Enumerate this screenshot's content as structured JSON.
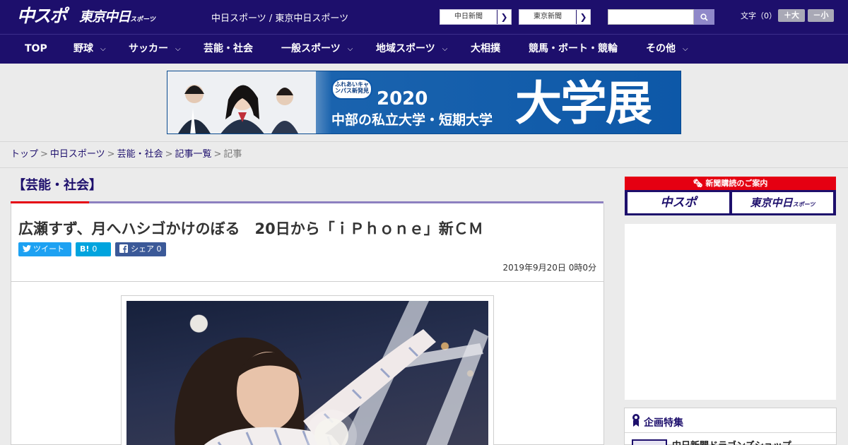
{
  "header": {
    "logo_main": "中スポ",
    "logo_tokyo": "東京中日",
    "logo_tokyo_small": "スポーツ",
    "site_links": "中日スポーツ / 東京中日スポーツ",
    "paper_buttons": [
      "中日新聞",
      "東京新聞"
    ],
    "search": {
      "value": "",
      "placeholder": ""
    },
    "font_size_label": "文字（0）",
    "font_size_increase": "＋大",
    "font_size_decrease": "－小",
    "brand_color": "#1d0f6c"
  },
  "nav": {
    "items": [
      {
        "label": "TOP",
        "has_dropdown": false
      },
      {
        "label": "野球",
        "has_dropdown": true
      },
      {
        "label": "サッカー",
        "has_dropdown": true
      },
      {
        "label": "芸能・社会",
        "has_dropdown": false
      },
      {
        "label": "一般スポーツ",
        "has_dropdown": true
      },
      {
        "label": "地域スポーツ",
        "has_dropdown": true
      },
      {
        "label": "大相撲",
        "has_dropdown": false
      },
      {
        "label": "競馬・ボート・競輪",
        "has_dropdown": false
      },
      {
        "label": "その他",
        "has_dropdown": true
      }
    ]
  },
  "banner": {
    "badge": "ふれあいキャンパス新発見",
    "year": "2020",
    "subtitle": "中部の私立大学・短期大学",
    "headline": "大学展"
  },
  "breadcrumb": {
    "items": [
      "トップ",
      "中日スポーツ",
      "芸能・社会",
      "記事一覧"
    ],
    "current": "記事"
  },
  "article": {
    "category": "【芸能・社会】",
    "headline": "広瀬すず、月へハシゴかけのぼる　20日から「ｉＰｈｏｎｅ」新ＣＭ",
    "share": {
      "tweet": "ツイート",
      "hatena_glyph": "B!",
      "hatena_count": "0",
      "facebook": "シェア",
      "facebook_count": "0"
    },
    "date": "2019年9月20日 0時0分",
    "accent_red": "#e50012",
    "accent_purple": "#8d80c0"
  },
  "sidebar": {
    "subscribe_title": "新聞購読のご案内",
    "subscribe_links": [
      "中スポ",
      "東京中日"
    ],
    "subscribe_link_small": "スポーツ",
    "special_title": "企画特集",
    "special_item": "中日新聞ドラゴンズショップ"
  }
}
